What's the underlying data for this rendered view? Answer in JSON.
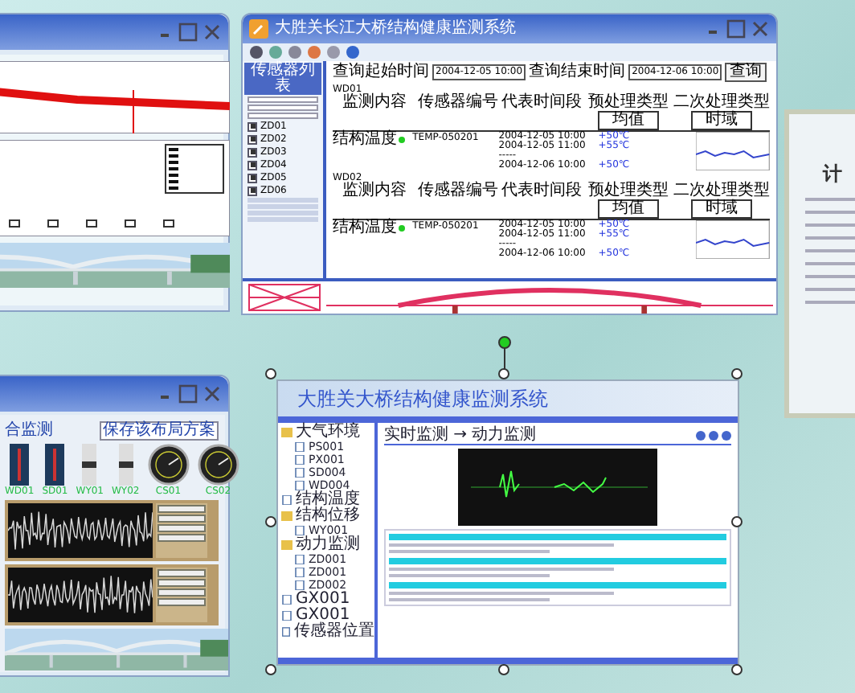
{
  "monitor_window": {
    "title": "大胜关长江大桥结构健康监测系统",
    "sensor_list": {
      "title": "传感器列表",
      "items": [
        {
          "label": "ZD01",
          "checked": true
        },
        {
          "label": "ZD02",
          "checked": true
        },
        {
          "label": "ZD03",
          "checked": true
        },
        {
          "label": "ZD04",
          "checked": true
        },
        {
          "label": "ZD05",
          "checked": true
        },
        {
          "label": "ZD06",
          "checked": true
        }
      ]
    },
    "query": {
      "start_label": "查询起始时间",
      "start": "2004-12-05 10:00",
      "end_label": "查询结束时间",
      "end": "2004-12-06 10:00",
      "button": "查询"
    },
    "blocks": [
      {
        "code": "WD01",
        "headers": [
          "监测内容",
          "传感器编号",
          "代表时间段"
        ],
        "pre_label": "预处理类型",
        "pre_value": "均值",
        "post_label": "二次处理类型",
        "post_value": "时域",
        "content": "结构温度",
        "sensor": "TEMP-050201",
        "rows": [
          {
            "kind": "reading",
            "time": "2004-12-05 10:00",
            "value": "+50℃"
          },
          {
            "kind": "reading",
            "time": "2004-12-05 11:00",
            "value": "+55℃"
          },
          {
            "kind": "gap",
            "text": "-----"
          },
          {
            "kind": "reading",
            "time": "2004-12-06 10:00",
            "value": "+50℃"
          }
        ]
      },
      {
        "code": "WD02",
        "headers": [
          "监测内容",
          "传感器编号",
          "代表时间段"
        ],
        "pre_label": "预处理类型",
        "pre_value": "均值",
        "post_label": "二次处理类型",
        "post_value": "时域",
        "content": "结构温度",
        "sensor": "TEMP-050201",
        "rows": [
          {
            "kind": "reading",
            "time": "2004-12-05 10:00",
            "value": "+50℃"
          },
          {
            "kind": "reading",
            "time": "2004-12-05 11:00",
            "value": "+55℃"
          },
          {
            "kind": "gap",
            "text": "-----"
          },
          {
            "kind": "reading",
            "time": "2004-12-06 10:00",
            "value": "+50℃"
          }
        ]
      }
    ]
  },
  "dashboard_window": {
    "heading": "合监测",
    "save_button": "保存该布局方案",
    "gauges": [
      {
        "kind": "thermometer",
        "label": "WD01"
      },
      {
        "kind": "thermometer",
        "label": "SD01"
      },
      {
        "kind": "slider",
        "label": "WY01"
      },
      {
        "kind": "slider",
        "label": "WY02"
      },
      {
        "kind": "dial",
        "label": "CS01"
      },
      {
        "kind": "dial",
        "label": "CS02"
      }
    ]
  },
  "web_window": {
    "title": "大胜关大桥结构健康监测系统",
    "breadcrumb": "实时监测 → 动力监测",
    "tree": [
      {
        "label": "大气环境",
        "children": [
          {
            "label": "PS001"
          },
          {
            "label": "PX001"
          },
          {
            "label": "SD004"
          },
          {
            "label": "WD004"
          }
        ]
      },
      {
        "label": "结构温度"
      },
      {
        "label": "结构位移",
        "children": [
          {
            "label": "WY001"
          }
        ]
      },
      {
        "label": "动力监测",
        "children": [
          {
            "label": "ZD001"
          },
          {
            "label": "ZD001"
          },
          {
            "label": "ZD002"
          }
        ]
      },
      {
        "label": "GX001"
      },
      {
        "label": "GX001"
      },
      {
        "label": "传感器位置"
      }
    ]
  },
  "certificate": {
    "heading": "计"
  }
}
